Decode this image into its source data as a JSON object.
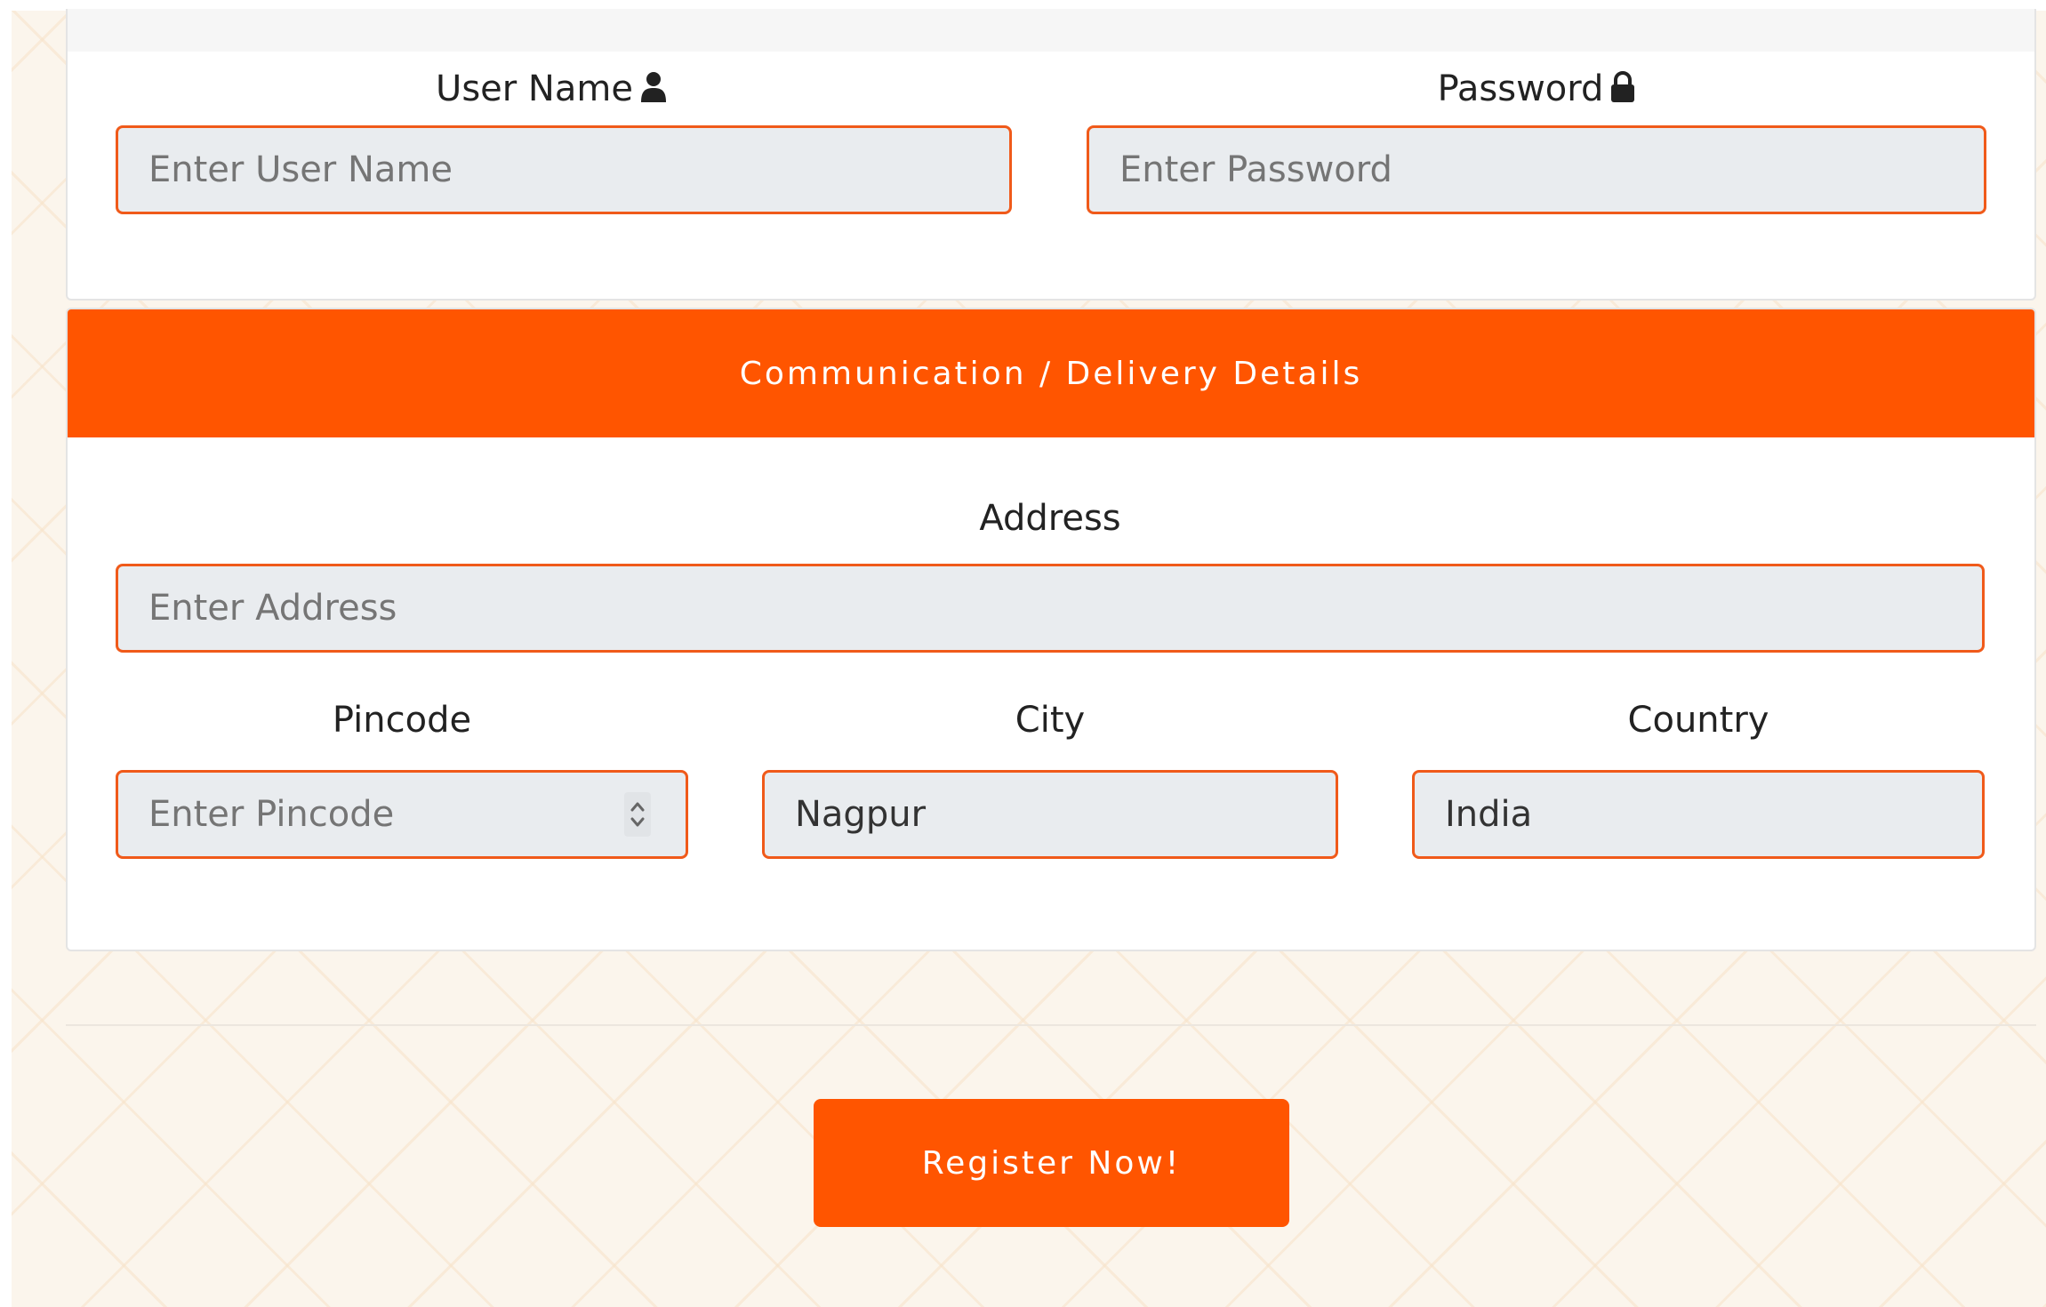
{
  "login": {
    "username_label": "User Name",
    "username_placeholder": "Enter User Name",
    "password_label": "Password",
    "password_placeholder": "Enter Password"
  },
  "delivery": {
    "header": "Communication / Delivery Details",
    "address_label": "Address",
    "address_placeholder": "Enter Address",
    "pincode_label": "Pincode",
    "pincode_placeholder": "Enter Pincode",
    "city_label": "City",
    "city_value": "Nagpur",
    "country_label": "Country",
    "country_value": "India"
  },
  "actions": {
    "register_label": "Register Now!"
  },
  "icons": {
    "username": "user-icon",
    "password": "lock-icon",
    "pincode_stepper": "stepper-icon"
  },
  "colors": {
    "accent": "#ff5500",
    "field_border": "#f05a1a",
    "field_background": "#e9ecef"
  }
}
